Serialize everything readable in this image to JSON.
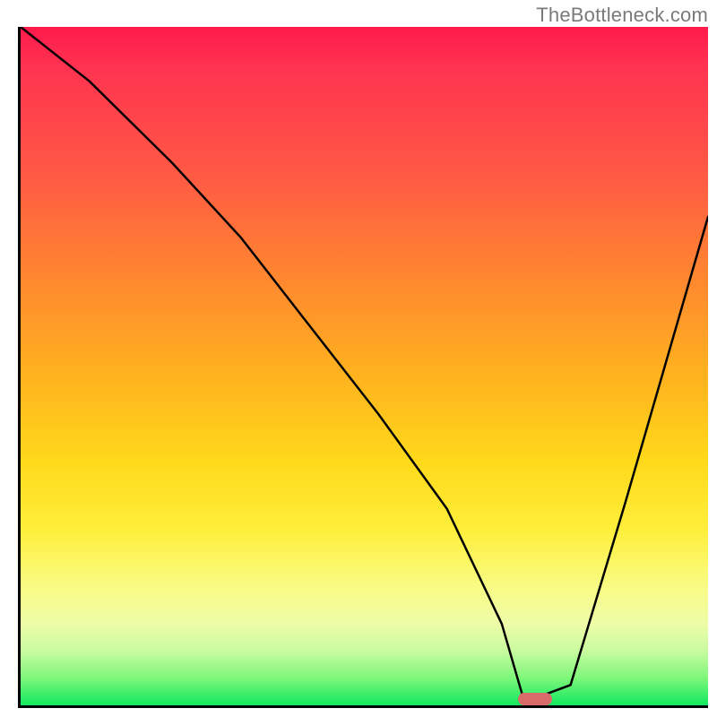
{
  "watermark": "TheBottleneck.com",
  "chart_data": {
    "type": "line",
    "title": "",
    "xlabel": "",
    "ylabel": "",
    "xlim": [
      0,
      100
    ],
    "ylim": [
      0,
      100
    ],
    "grid": false,
    "legend": false,
    "series": [
      {
        "name": "bottleneck-curve",
        "x": [
          0,
          10,
          22,
          32,
          42,
          52,
          62,
          70,
          73,
          76,
          80,
          88,
          96,
          100
        ],
        "y": [
          100,
          92,
          80,
          69,
          56,
          43,
          29,
          12,
          1.5,
          1.5,
          3,
          30,
          58,
          72
        ]
      }
    ],
    "optimal_marker": {
      "x": 74.5,
      "y": 1.3
    },
    "background_gradient": {
      "top": "#ff1a4c",
      "mid": "#ffd91a",
      "bottom": "#10e85e"
    }
  }
}
